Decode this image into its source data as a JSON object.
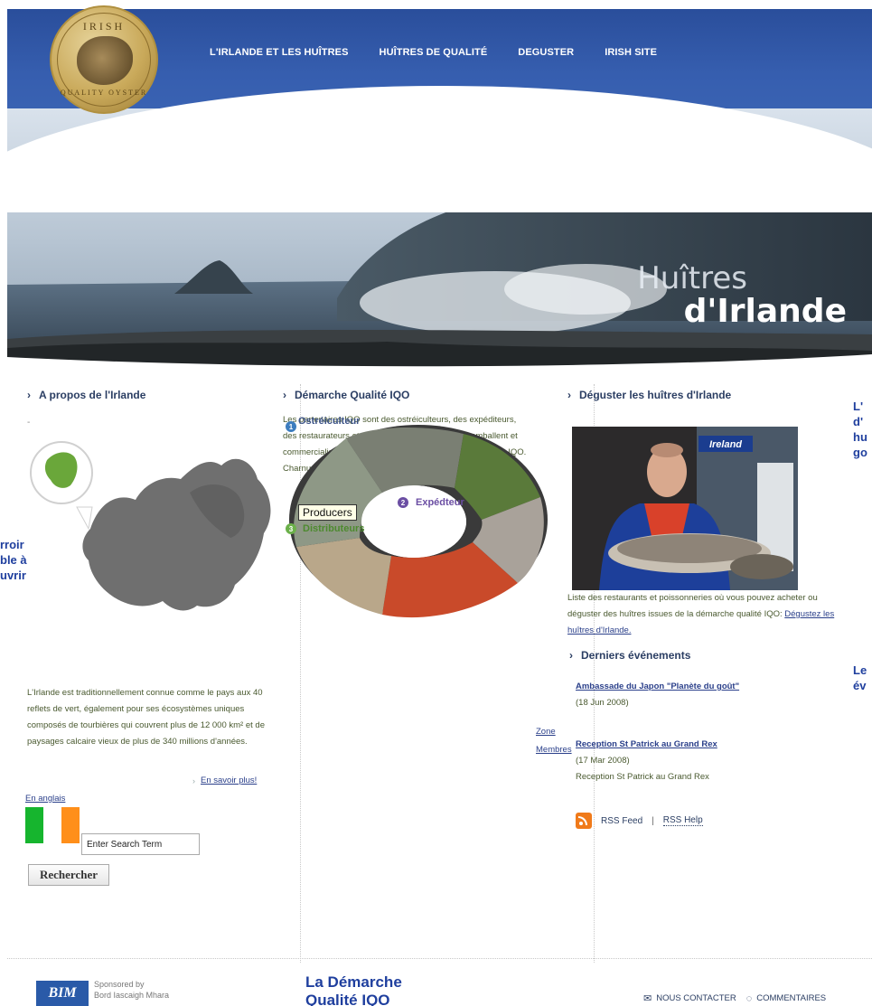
{
  "logo": {
    "top_text": "IRISH",
    "bottom_text": "QUALITY OYSTER"
  },
  "nav": [
    "L'IRLANDE ET LES HUÎTRES",
    "HUÎTRES DE QUALITÉ",
    "DEGUSTER",
    "IRISH SITE"
  ],
  "hero": {
    "line1": "Huîtres",
    "line2": "d'Irlande"
  },
  "col1": {
    "heading": "A propos de l'Irlande",
    "dash": "-",
    "paragraph": "L'Irlande est traditionnellement connue comme le pays aux 40 reflets de vert, également pour ses écosystèmes uniques composés de tourbières qui couvrent plus de 12 000 km² et de paysages calcaire vieux de plus de 340 millions d'années.",
    "more_link": "En savoir plus!",
    "english_link": "En anglais",
    "search_placeholder": "Enter Search Term",
    "search_button": "Rechercher"
  },
  "left_overflow": [
    "rroir",
    "ble à",
    "uvrir"
  ],
  "col2": {
    "heading": "Démarche Qualité IQO",
    "paragraph": "Les partenaires IQO sont des ostréiculteurs, des expéditeurs, des restaurateurs et poissonniers qui produisent, emballent et commercialisent des huîtres issues de la démarche qualité IQO. Charnues et croquantes ces huîtres sont un produit d'exception.",
    "steps": [
      {
        "num": "1",
        "label": "Ostréiculteur"
      },
      {
        "num": "2",
        "label": "Expédteur"
      },
      {
        "num": "3",
        "label": "Distributeurs"
      }
    ],
    "tooltip": "Producers",
    "zone_link": "Zone Membres"
  },
  "col3": {
    "heading": "Déguster les huîtres d'Irlande",
    "photo_sign": "Ireland",
    "paragraph": "Liste des restaurants et poissonneries où vous pouvez acheter ou déguster des huîtres issues de la démarche qualité IQO:",
    "inline_link": "Dégustez les huîtres d'Irlande.",
    "events_heading": "Derniers événements",
    "events": [
      {
        "title": "Ambassade du Japon \"Planète du goût\"",
        "date": "(18 Jun 2008)",
        "desc": ""
      },
      {
        "title": "Reception St Patrick au Grand Rex",
        "date": "(17 Mar 2008)",
        "desc": "Reception St Patrick au Grand Rex"
      }
    ],
    "rss_feed": "RSS Feed",
    "rss_sep": "|",
    "rss_help": "RSS Help"
  },
  "right_overflow_1": [
    "L'",
    "d'",
    "hu",
    "go"
  ],
  "right_overflow_2": [
    "Le",
    "év"
  ],
  "footer": {
    "sponsor_logo": "BIM",
    "sponsored_by": "Sponsored by",
    "sponsor_name": "Bord Iascaigh Mhara",
    "demarche_title_1": "La Démarche",
    "demarche_title_2": "Qualité IQO",
    "contact": "NOUS CONTACTER",
    "comments": "COMMENTAIRES"
  },
  "colors": {
    "nav_blue": "#365eaf",
    "heading": "#2b3e63",
    "link": "#2a3f8a",
    "overflow_text": "#1f3f9e",
    "step_blue": "#3d7dbf",
    "step_purple": "#6b4ea3",
    "step_green": "#6bb04a",
    "flag_green": "#16b52e",
    "flag_orange": "#ff8f1a",
    "map_green": "#6aa73a"
  }
}
